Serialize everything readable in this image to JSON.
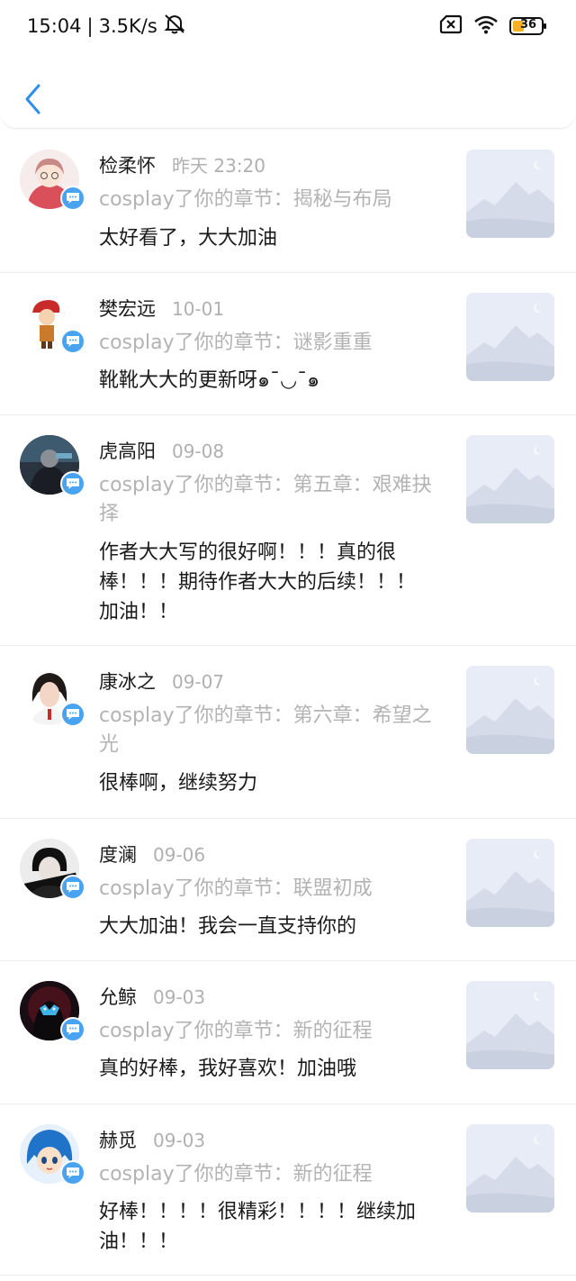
{
  "status_bar": {
    "time": "15:04",
    "network_speed": "3.5K/s",
    "battery_level": "36"
  },
  "header": {
    "back_icon": "chevron-left-icon"
  },
  "colors": {
    "badge_blue": "#4aa3f0",
    "back_blue": "#2f8fe8",
    "muted_text": "#b3b3b3"
  },
  "comments": [
    {
      "name": "检柔怀",
      "time": "昨天 23:20",
      "chapter": "cosplay了你的章节：揭秘与布局",
      "text": "太好看了，大大加油"
    },
    {
      "name": "樊宏远",
      "time": "10-01",
      "chapter": "cosplay了你的章节：谜影重重",
      "text": "靴靴大大的更新呀๑¯◡¯๑"
    },
    {
      "name": "虎高阳",
      "time": "09-08",
      "chapter": "cosplay了你的章节：第五章：艰难抉择",
      "text": "作者大大写的很好啊！！！真的很棒！！！期待作者大大的后续！！！加油！！"
    },
    {
      "name": "康冰之",
      "time": "09-07",
      "chapter": "cosplay了你的章节：第六章：希望之光",
      "text": "很棒啊，继续努力"
    },
    {
      "name": "度澜",
      "time": "09-06",
      "chapter": "cosplay了你的章节：联盟初成",
      "text": "大大加油！我会一直支持你的"
    },
    {
      "name": "允鲸",
      "time": "09-03",
      "chapter": "cosplay了你的章节：新的征程",
      "text": "真的好棒，我好喜欢！加油哦"
    },
    {
      "name": "赫觅",
      "time": "09-03",
      "chapter": "cosplay了你的章节：新的征程",
      "text": "好棒！！！！很精彩！！！！继续加油！！！"
    }
  ]
}
